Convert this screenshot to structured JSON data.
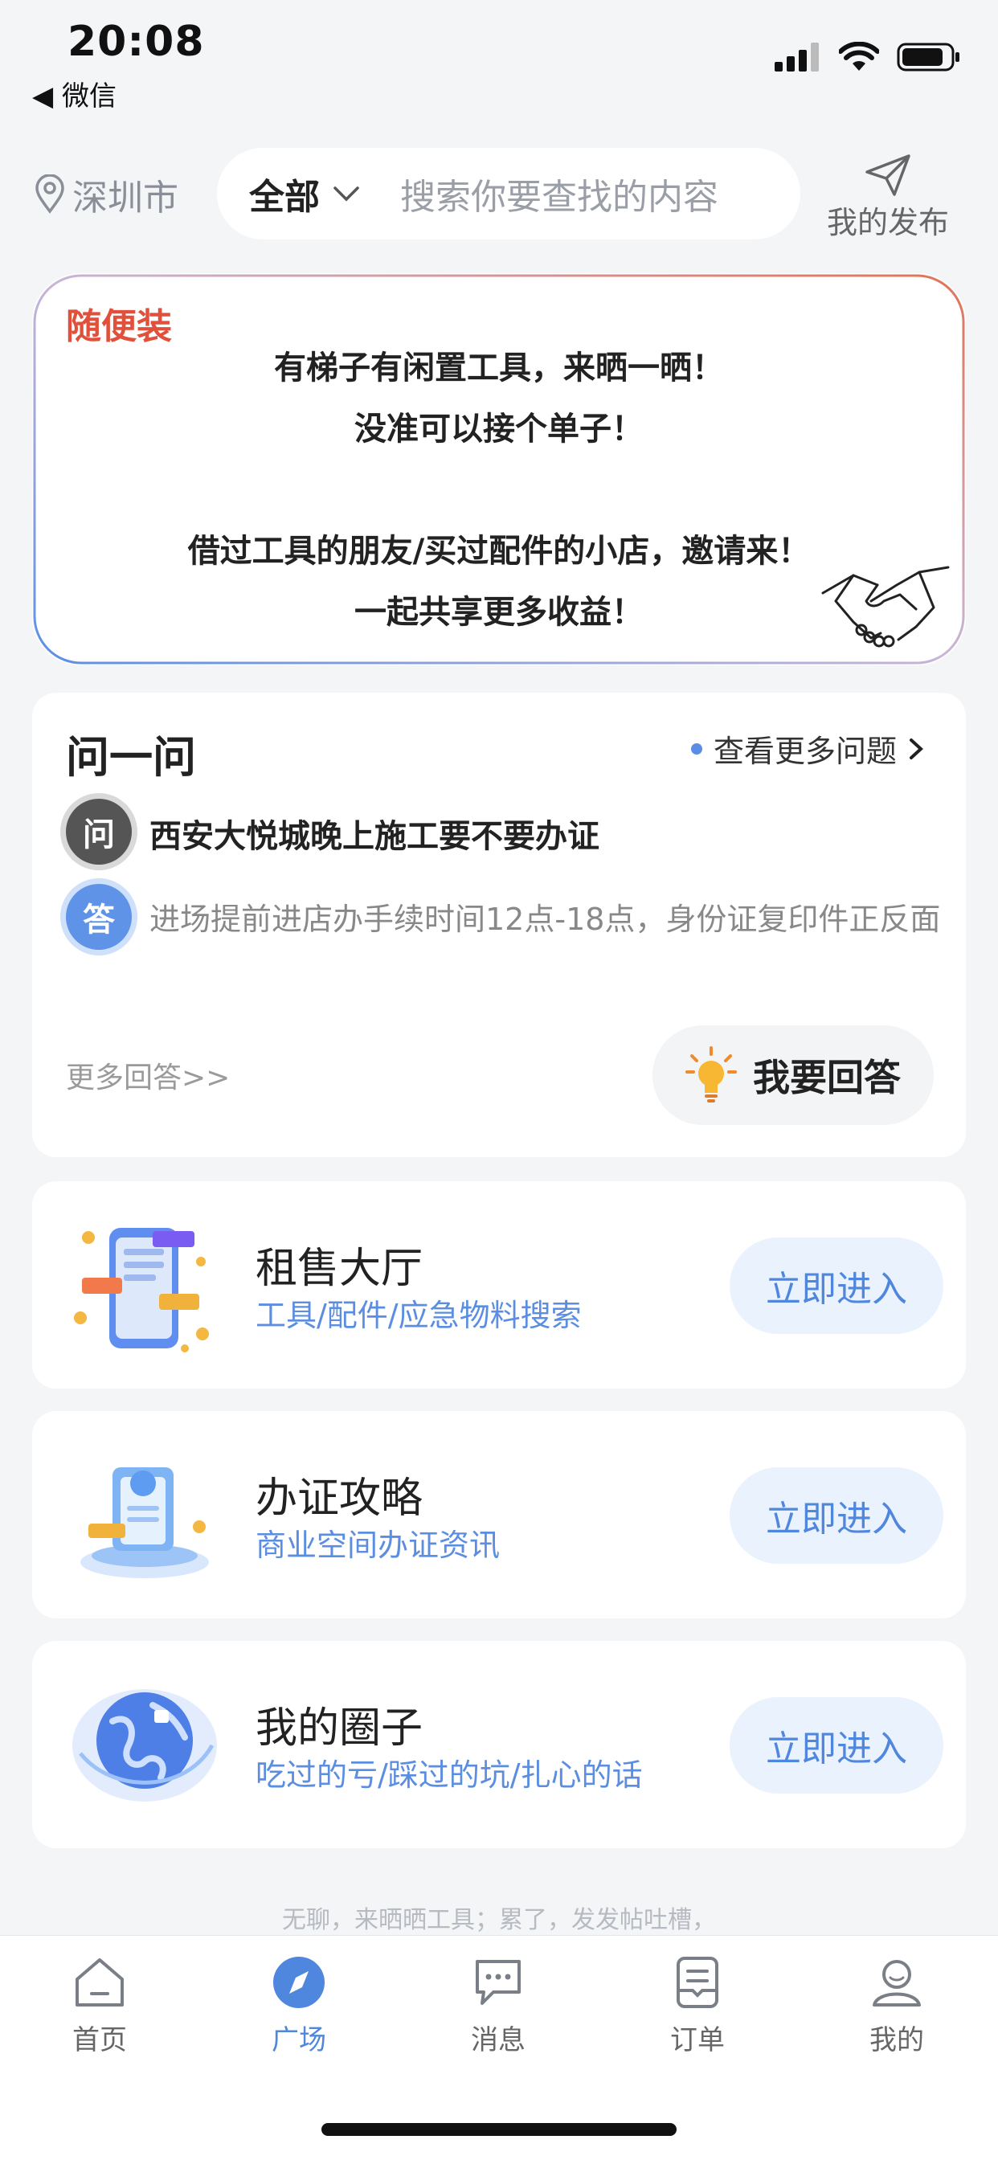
{
  "status_bar": {
    "time": "20:08",
    "back_label": "◀ 微信"
  },
  "header": {
    "city": "深圳市",
    "search_scope": "全部",
    "search_placeholder": "搜索你要查找的内容",
    "publish_label": "我的发布"
  },
  "banner": {
    "tag": "随便装",
    "lines": [
      "有梯子有闲置工具，来晒一晒！",
      "没准可以接个单子！",
      "",
      "借过工具的朋友/买过配件的小店，邀请来！",
      "一起共享更多收益！"
    ]
  },
  "qa": {
    "title": "问一问",
    "more_questions": "查看更多问题",
    "q_badge": "问",
    "question": "西安大悦城晚上施工要不要办证",
    "a_badge": "答",
    "answer": "进场提前进店办手续时间12点-18点，身份证复印件正反面",
    "more_answers": "更多回答>>",
    "answer_button": "我要回答"
  },
  "cards": [
    {
      "title": "租售大厅",
      "subtitle": "工具/配件/应急物料搜索",
      "button": "立即进入"
    },
    {
      "title": "办证攻略",
      "subtitle": "商业空间办证资讯",
      "button": "立即进入"
    },
    {
      "title": "我的圈子",
      "subtitle": "吃过的亏/踩过的坑/扎心的话",
      "button": "立即进入"
    }
  ],
  "footer_note": "无聊，来晒晒工具；累了，发发帖吐槽，",
  "tabs": [
    {
      "label": "首页",
      "icon": "home-icon"
    },
    {
      "label": "广场",
      "icon": "compass-icon"
    },
    {
      "label": "消息",
      "icon": "message-icon"
    },
    {
      "label": "订单",
      "icon": "order-icon"
    },
    {
      "label": "我的",
      "icon": "profile-icon"
    }
  ],
  "colors": {
    "accent": "#4f86de",
    "tag_red": "#e0503a",
    "background": "#f4f5f7"
  }
}
